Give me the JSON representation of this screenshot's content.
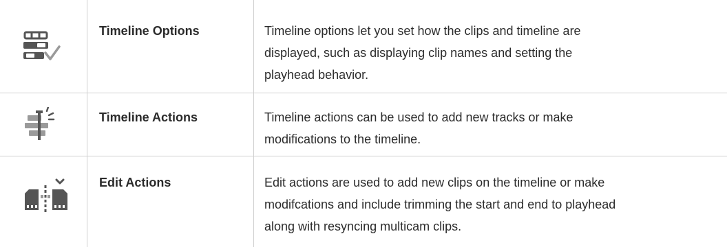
{
  "rows": [
    {
      "icon": "timeline-options-icon",
      "name": "Timeline Options",
      "description_lines": [
        "Timeline options let you set how the clips and timeline are",
        "displayed, such as displaying clip names and setting the",
        "playhead behavior."
      ]
    },
    {
      "icon": "timeline-actions-icon",
      "name": "Timeline Actions",
      "description_lines": [
        "Timeline actions can be used to add new tracks or make",
        "modifications to the timeline."
      ]
    },
    {
      "icon": "edit-actions-icon",
      "name": "Edit Actions",
      "description_lines": [
        "Edit actions are used to add new clips on the timeline or make",
        "modifcations and include trimming the start and end to playhead",
        "along with resyncing multicam clips."
      ]
    }
  ],
  "colors": {
    "icon": "#555555",
    "icon_light": "#9a9a9a",
    "rule": "#cfcfcf",
    "text": "#2b2b2b"
  }
}
